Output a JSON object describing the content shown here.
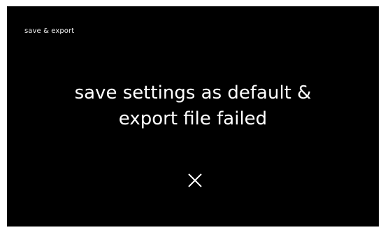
{
  "screen": {
    "title": "save & export",
    "message_line1": "save settings as default &",
    "message_line2": "export file failed",
    "close_icon": "close-icon",
    "colors": {
      "background": "#000000",
      "text": "#ffffff"
    }
  }
}
